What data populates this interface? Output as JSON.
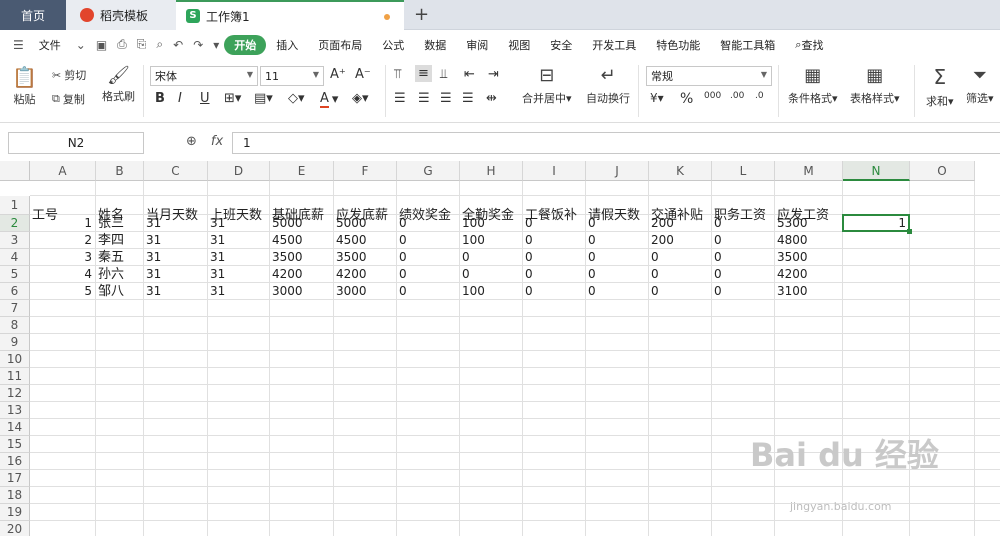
{
  "tabs": {
    "home": "首页",
    "template": "稻壳模板",
    "workbook": "工作簿1",
    "workbook_icon": "S"
  },
  "menu": {
    "file": "文件",
    "items": [
      "开始",
      "插入",
      "页面布局",
      "公式",
      "数据",
      "审阅",
      "视图",
      "安全",
      "开发工具",
      "特色功能",
      "智能工具箱"
    ],
    "search": "查找"
  },
  "ribbon": {
    "paste": "粘贴",
    "cut": "剪切",
    "copy": "复制",
    "format_painter": "格式刷",
    "font_name": "宋体",
    "font_size": "11",
    "merge_center": "合并居中",
    "wrap_text": "自动换行",
    "number_format": "常规",
    "conditional_format": "条件格式",
    "table_style": "表格样式",
    "sum": "求和",
    "filter": "筛选"
  },
  "formula_bar": {
    "name_box": "N2",
    "fx": "fx",
    "value": "1"
  },
  "sheet": {
    "columns": [
      "A",
      "B",
      "C",
      "D",
      "E",
      "F",
      "G",
      "H",
      "I",
      "J",
      "K",
      "L",
      "M",
      "N",
      "O"
    ],
    "rows": [
      "1",
      "2",
      "3",
      "4",
      "5",
      "6",
      "7",
      "8",
      "9",
      "10",
      "11",
      "12",
      "13",
      "14",
      "15",
      "16",
      "17",
      "18",
      "19",
      "20"
    ],
    "selected_column": "N",
    "selected_row": "2",
    "headers": [
      "工号",
      "姓名",
      "当月天数",
      "上班天数",
      "基础底薪",
      "应发底薪",
      "绩效奖金",
      "全勤奖金",
      "工餐饭补",
      "请假天数",
      "交通补贴",
      "职务工资",
      "应发工资"
    ],
    "data": [
      [
        "1",
        "张三",
        "31",
        "31",
        "5000",
        "5000",
        "0",
        "100",
        "0",
        "0",
        "200",
        "0",
        "5300"
      ],
      [
        "2",
        "李四",
        "31",
        "31",
        "4500",
        "4500",
        "0",
        "100",
        "0",
        "0",
        "200",
        "0",
        "4800"
      ],
      [
        "3",
        "秦五",
        "31",
        "31",
        "3500",
        "3500",
        "0",
        "0",
        "0",
        "0",
        "0",
        "0",
        "3500"
      ],
      [
        "4",
        "孙六",
        "31",
        "31",
        "4200",
        "4200",
        "0",
        "0",
        "0",
        "0",
        "0",
        "0",
        "4200"
      ],
      [
        "5",
        "邹八",
        "31",
        "31",
        "3000",
        "3000",
        "0",
        "100",
        "0",
        "0",
        "0",
        "0",
        "3100"
      ]
    ],
    "n2_value": "1"
  },
  "watermark": {
    "text": "Bai du 经验",
    "url": "jingyan.baidu.com"
  }
}
